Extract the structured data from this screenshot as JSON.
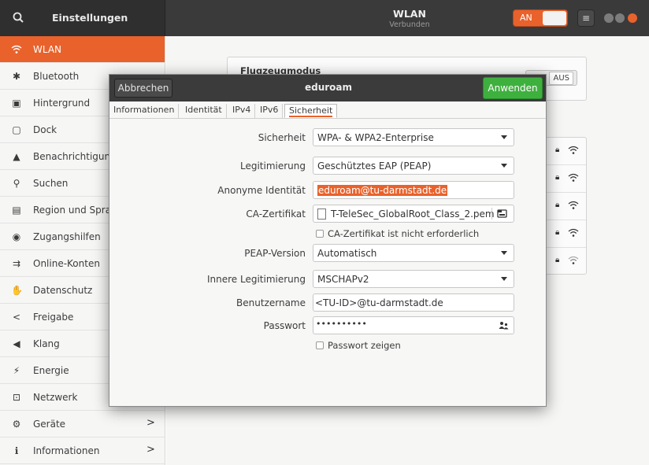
{
  "header": {
    "app_title": "Einstellungen",
    "panel_title": "WLAN",
    "panel_subtitle": "Verbunden",
    "wifi_toggle_label": "AN",
    "menu_icon": "hamburger-icon",
    "accent_color": "#e9622b"
  },
  "sidebar": {
    "items": [
      {
        "label": "WLAN",
        "icon": "wifi-icon",
        "active": true
      },
      {
        "label": "Bluetooth",
        "icon": "bluetooth-icon"
      },
      {
        "label": "Hintergrund",
        "icon": "monitor-icon"
      },
      {
        "label": "Dock",
        "icon": "dock-icon"
      },
      {
        "label": "Benachrichtigungen",
        "icon": "bell-icon"
      },
      {
        "label": "Suchen",
        "icon": "search-icon"
      },
      {
        "label": "Region und Sprache",
        "icon": "keyboard-icon"
      },
      {
        "label": "Zugangshilfen",
        "icon": "accessibility-icon"
      },
      {
        "label": "Online-Konten",
        "icon": "online-accounts-icon"
      },
      {
        "label": "Datenschutz",
        "icon": "hand-icon"
      },
      {
        "label": "Freigabe",
        "icon": "share-icon"
      },
      {
        "label": "Klang",
        "icon": "speaker-icon"
      },
      {
        "label": "Energie",
        "icon": "battery-icon"
      },
      {
        "label": "Netzwerk",
        "icon": "network-icon"
      },
      {
        "label": "Geräte",
        "icon": "devices-icon",
        "chevron": ">"
      },
      {
        "label": "Informationen",
        "icon": "info-icon",
        "chevron": ">"
      }
    ]
  },
  "main": {
    "airplane_mode_title": "Flugzeugmodus",
    "airplane_mode_state": "AUS"
  },
  "dialog": {
    "title": "eduroam",
    "cancel_label": "Abbrechen",
    "apply_label": "Anwenden",
    "tabs": [
      "Informationen",
      "Identität",
      "IPv4",
      "IPv6",
      "Sicherheit"
    ],
    "active_tab": "Sicherheit",
    "fields": {
      "security_label": "Sicherheit",
      "security_value": "WPA- & WPA2-Enterprise",
      "auth_label": "Legitimierung",
      "auth_value": "Geschütztes EAP (PEAP)",
      "anon_identity_label": "Anonyme Identität",
      "anon_identity_value": "eduroam@tu-darmstadt.de",
      "ca_cert_label": "CA-Zertifikat",
      "ca_cert_value": "T-TeleSec_GlobalRoot_Class_2.pem",
      "ca_cert_not_required_label": "CA-Zertifikat ist nicht erforderlich",
      "peap_version_label": "PEAP-Version",
      "peap_version_value": "Automatisch",
      "inner_auth_label": "Innere Legitimierung",
      "inner_auth_value": "MSCHAPv2",
      "username_label": "Benutzername",
      "username_value": "<TU-ID>@tu-darmstadt.de",
      "password_label": "Passwort",
      "password_value": "••••••••••",
      "show_password_label": "Passwort zeigen"
    }
  }
}
